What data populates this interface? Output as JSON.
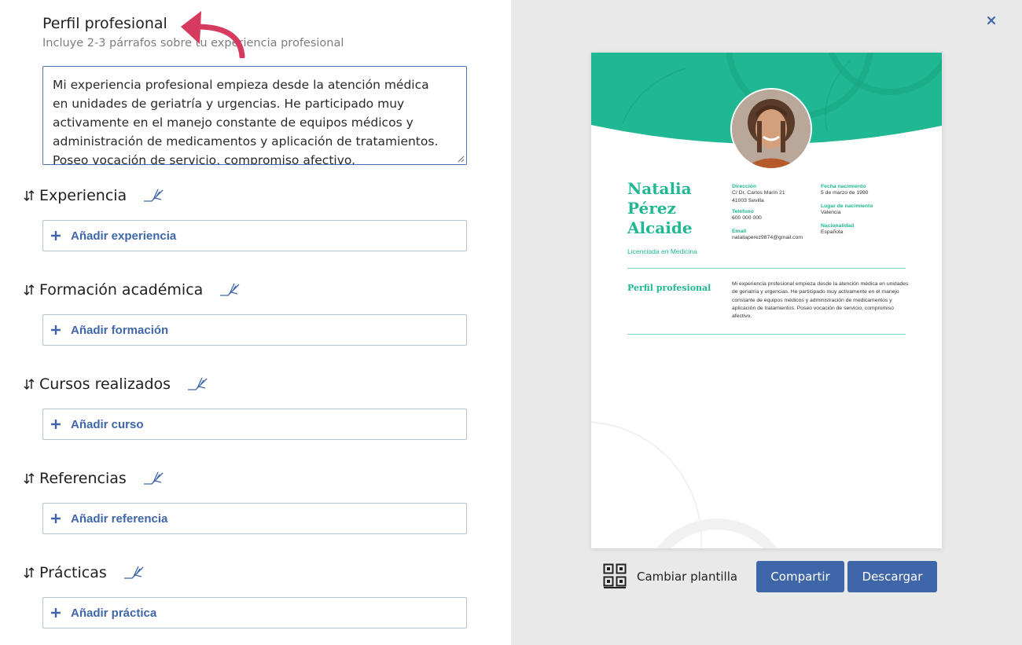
{
  "editor": {
    "profile": {
      "title": "Perfil profesional",
      "subtitle": "Incluye 2-3 párrafos sobre tu experiencia profesional",
      "text": "Mi experiencia profesional empieza desde la atención médica en unidades de geriatría y urgencias. He participado muy activamente en el manejo constante de equipos médicos y administración de medicamentos y aplicación de tratamientos. Poseo vocación de servicio, compromiso afectivo."
    },
    "sections": [
      {
        "title": "Experiencia",
        "add_label": "Añadir experiencia"
      },
      {
        "title": "Formación académica",
        "add_label": "Añadir formación"
      },
      {
        "title": "Cursos realizados",
        "add_label": "Añadir curso"
      },
      {
        "title": "Referencias",
        "add_label": "Añadir referencia"
      },
      {
        "title": "Prácticas",
        "add_label": "Añadir práctica"
      }
    ]
  },
  "preview": {
    "name_line1": "Natalia",
    "name_line2": "Pérez",
    "name_line3": "Alcaide",
    "role": "Licenciada en Medicina",
    "direccion_label": "Dirección",
    "direccion_line1": "C/ Dr. Carlos Marín 21",
    "direccion_line2": "41003 Sevilla",
    "telefono_label": "Teléfono",
    "telefono": "600 000 000",
    "email_label": "Email",
    "email": "nataliaperez9874@gmail.com",
    "fecha_label": "Fecha nacimiento",
    "fecha": "5 de marzo de 1990",
    "lugar_label": "Lugar de nacimiento",
    "lugar": "Valencia",
    "nacionalidad_label": "Nacionalidad",
    "nacionalidad": "Española",
    "perfil_title": "Perfil profesional",
    "perfil_text": "Mi experiencia profesional empieza desde la atención médica en unidades de geriatría y urgencias. He participado muy activamente en el manejo constante de equipos médicos y administración de medicamentos y aplicación de tratamientos. Poseo vocación de servicio, compromiso afectivo."
  },
  "actions": {
    "change_template": "Cambiar plantilla",
    "share": "Compartir",
    "download": "Descargar"
  },
  "colors": {
    "accent_teal": "#1fb892",
    "button_blue": "#3e66a8",
    "arrow_red": "#d63a5e"
  },
  "icons": [
    "sort-icon",
    "edit-icon",
    "plus-icon",
    "close-icon",
    "template-icon",
    "arrow-annotation-icon"
  ]
}
